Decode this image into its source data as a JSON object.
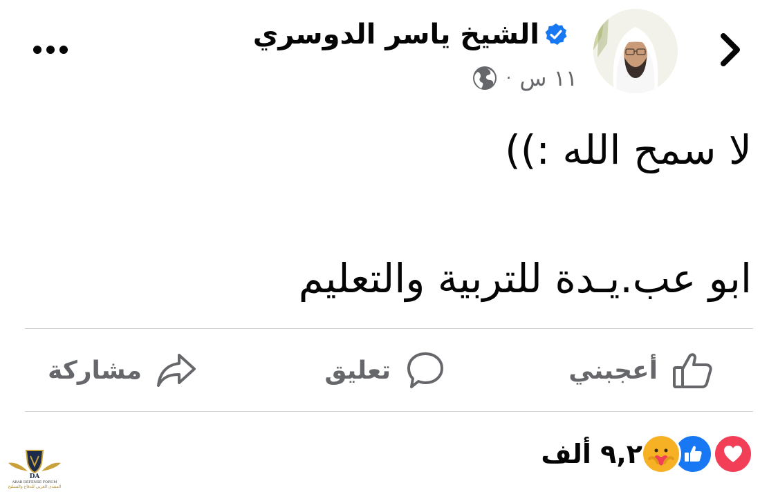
{
  "header": {
    "author_name": "الشيخ ياسر الدوسري",
    "time": "١١ س",
    "meta_separator": "·",
    "verified": true,
    "privacy_icon": "globe-icon",
    "back_icon": "chevron-right-icon",
    "more_icon": "more-dots-icon"
  },
  "post": {
    "lines": [
      "لا سمح الله :))",
      "ابو عب.يـدة للتربية والتعليم"
    ]
  },
  "actions": {
    "like_label": "أعجبني",
    "comment_label": "تعليق",
    "share_label": "مشاركة"
  },
  "reactions": {
    "count": "٩,٢ ألف",
    "icons": [
      "love-icon",
      "like-icon",
      "care-icon"
    ]
  },
  "watermark": {
    "badge": "DA",
    "line1": "ARAB DEFENSE FORUM",
    "line2": "المنتدى العربي للدفاع والتسليح"
  },
  "colors": {
    "text_primary": "#050505",
    "text_secondary": "#65676b",
    "verified_blue": "#1877f2",
    "divider": "#d0d2d6",
    "love_red": "#f33e58",
    "care_yellow": "#f7b125"
  }
}
